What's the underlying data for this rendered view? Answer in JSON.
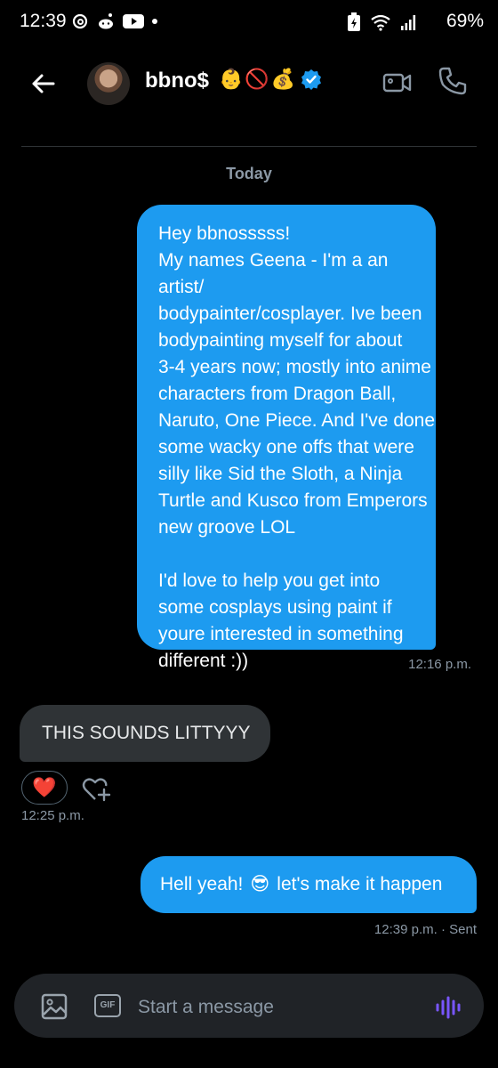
{
  "status_bar": {
    "time": "12:39",
    "battery": "69%"
  },
  "header": {
    "contact_name": "bbno$",
    "name_emojis": [
      "👶",
      "🚫",
      "💰"
    ],
    "verified": true
  },
  "conversation": {
    "date_label": "Today",
    "messages": [
      {
        "direction": "outgoing",
        "text": "Hey bbnosssss!\nMy names Geena - I'm a an artist/\nbodypainter/cosplayer. Ive been\nbodypainting myself for about\n3-4 years now; mostly into anime\ncharacters from Dragon Ball,\nNaruto, One Piece. And I've done\nsome wacky one offs that were\nsilly like Sid the Sloth, a Ninja\nTurtle and Kusco from Emperors\nnew groove LOL\n\nI'd love to help you get into\nsome cosplays using paint if\nyoure interested in something\ndifferent :))",
        "time": "12:16 p.m."
      },
      {
        "direction": "incoming",
        "text": "THIS SOUNDS LITTYYY",
        "reaction": "❤️",
        "time": "12:25 p.m."
      },
      {
        "direction": "outgoing",
        "text_before": "Hell yeah!",
        "emoji": "😎",
        "text_after": "let's make it happen",
        "time": "12:39 p.m. · Sent"
      }
    ]
  },
  "composer": {
    "placeholder": "Start a message",
    "gif_label": "GIF"
  },
  "colors": {
    "accent": "#1d9bf0",
    "incoming_bubble": "#2f3336",
    "background": "#000000"
  }
}
